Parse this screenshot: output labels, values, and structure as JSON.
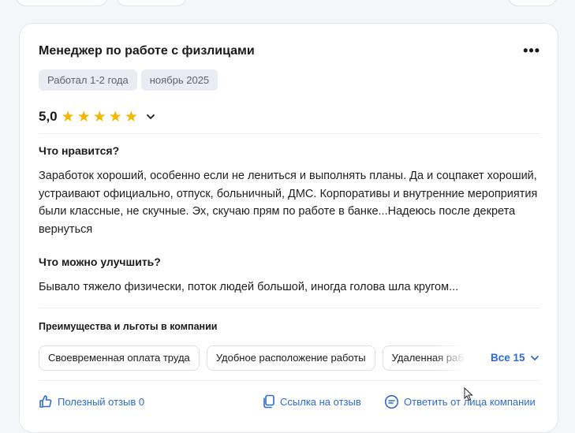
{
  "review": {
    "title": "Менеджер по работе с физлицами",
    "more_label": "•••",
    "tags": [
      "Работал 1-2 года",
      "ноябрь 2025"
    ],
    "rating": "5,0",
    "stars": 5,
    "likes_heading": "Что нравится?",
    "likes_text": "Заработок хороший, особенно если не лениться и выполнять планы. Да и соцпакет хороший, устраивают официально, отпуск, больничный, ДМС. Корпоративы и внутренние мероприятия были классные, не скучные. Эх, скучаю прям по работе в банке...Надеюсь после декрета вернуться",
    "improve_heading": "Что можно улучшить?",
    "improve_text": "Бывало тяжело физически, поток людей большой, иногда голова шла кругом...",
    "benefits_heading": "Преимущества и льготы в компании",
    "benefits": [
      "Своевременная оплата труда",
      "Удобное расположение работы",
      "Удаленная работа"
    ],
    "benefits_all": "Все 15",
    "useful_label": "Полезный отзыв 0",
    "link_label": "Ссылка на отзыв",
    "reply_label": "Ответить от лица компании"
  },
  "colors": {
    "accent": "#2d6bd0",
    "star": "#f5b700",
    "tag_bg": "#e9edf3"
  }
}
